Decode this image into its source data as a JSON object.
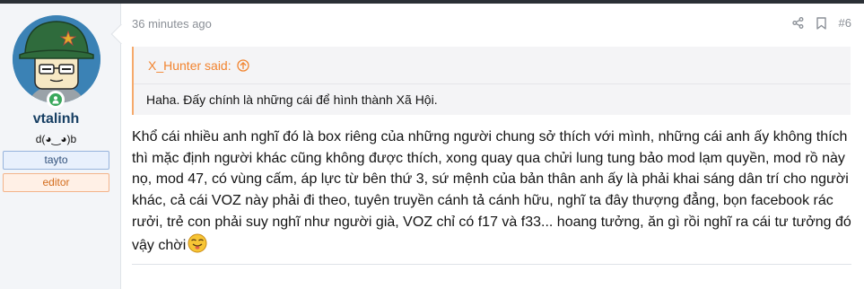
{
  "user": {
    "username": "vtalinh",
    "title": "d(◕‿◕)b",
    "banners": [
      "tayto",
      "editor"
    ]
  },
  "post": {
    "timestamp": "36 minutes ago",
    "number": "#6",
    "quote": {
      "author_said": "X_Hunter said:",
      "text": "Haha. Đấy chính là những cái để hình thành Xã Hội."
    },
    "body": "Khổ cái nhiều anh nghĩ đó là box riêng của những người chung sở thích với mình, những cái anh ấy không thích thì mặc định người khác cũng không được thích, xong quay qua chửi lung tung bảo mod lạm quyền, mod rồ này nọ, mod 47, có vùng cấm, áp lực từ bên thứ 3, sứ mệnh của bản thân anh ấy là phải khai sáng dân trí cho người khác, cả cái VOZ này phải đi theo, tuyên truyền cánh tả cánh hữu, nghĩ ta đây thượng đẳng, bọn facebook rác rưởi, trẻ con phải suy nghĩ như người già, VOZ chỉ có f17 và f33... hoang tưởng, ăn gì rồi nghĩ ra cái tư tưởng đó vậy chời"
  },
  "colors": {
    "username": "#173f63",
    "quote_accent": "#f2842f",
    "online": "#3aa85c",
    "banner_tayto": "#30507a",
    "banner_editor": "#d36d1e"
  },
  "icons": [
    "share-icon",
    "bookmark-icon",
    "quote-jump-icon",
    "online-icon",
    "emoji-icon"
  ]
}
